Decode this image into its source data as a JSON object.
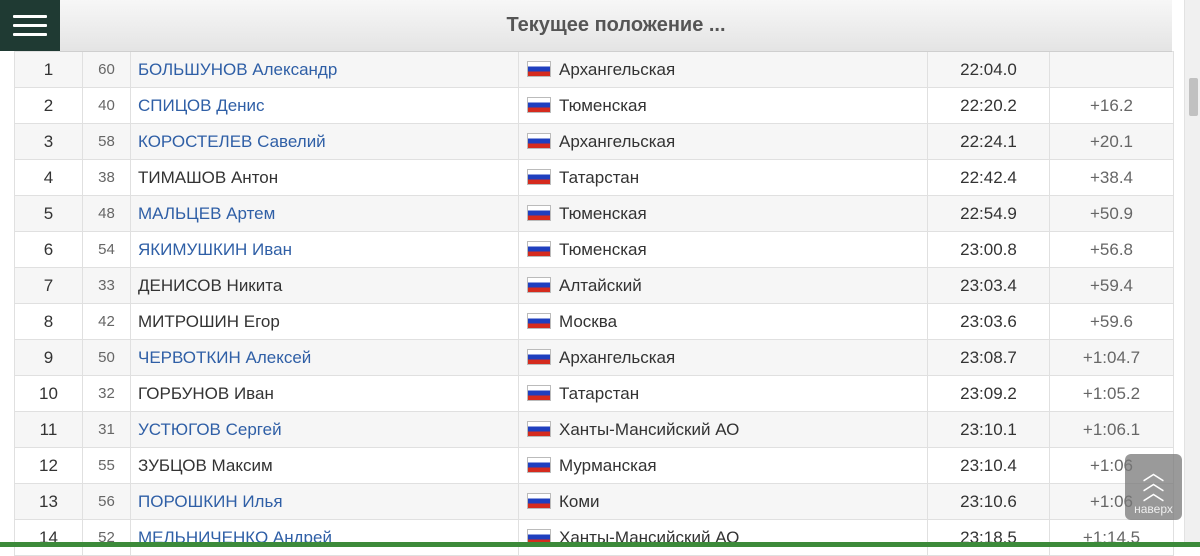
{
  "header": {
    "title": "Текущее положение ..."
  },
  "back_to_top": {
    "label": "наверх"
  },
  "results": [
    {
      "place": "1",
      "bib": "60",
      "name": "БОЛЬШУНОВ Александр",
      "link": true,
      "region": "Архангельская",
      "time": "22:04.0",
      "gap": ""
    },
    {
      "place": "2",
      "bib": "40",
      "name": "СПИЦОВ Денис",
      "link": true,
      "region": "Тюменская",
      "time": "22:20.2",
      "gap": "+16.2"
    },
    {
      "place": "3",
      "bib": "58",
      "name": "КОРОСТЕЛЕВ Савелий",
      "link": true,
      "region": "Архангельская",
      "time": "22:24.1",
      "gap": "+20.1"
    },
    {
      "place": "4",
      "bib": "38",
      "name": "ТИМАШОВ Антон",
      "link": false,
      "region": "Татарстан",
      "time": "22:42.4",
      "gap": "+38.4"
    },
    {
      "place": "5",
      "bib": "48",
      "name": "МАЛЬЦЕВ Артем",
      "link": true,
      "region": "Тюменская",
      "time": "22:54.9",
      "gap": "+50.9"
    },
    {
      "place": "6",
      "bib": "54",
      "name": "ЯКИМУШКИН Иван",
      "link": true,
      "region": "Тюменская",
      "time": "23:00.8",
      "gap": "+56.8"
    },
    {
      "place": "7",
      "bib": "33",
      "name": "ДЕНИСОВ Никита",
      "link": false,
      "region": "Алтайский",
      "time": "23:03.4",
      "gap": "+59.4"
    },
    {
      "place": "8",
      "bib": "42",
      "name": "МИТРОШИН Егор",
      "link": false,
      "region": "Москва",
      "time": "23:03.6",
      "gap": "+59.6"
    },
    {
      "place": "9",
      "bib": "50",
      "name": "ЧЕРВОТКИН Алексей",
      "link": true,
      "region": "Архангельская",
      "time": "23:08.7",
      "gap": "+1:04.7"
    },
    {
      "place": "10",
      "bib": "32",
      "name": "ГОРБУНОВ Иван",
      "link": false,
      "region": "Татарстан",
      "time": "23:09.2",
      "gap": "+1:05.2"
    },
    {
      "place": "11",
      "bib": "31",
      "name": "УСТЮГОВ Сергей",
      "link": true,
      "region": "Ханты-Мансийский АО",
      "time": "23:10.1",
      "gap": "+1:06.1"
    },
    {
      "place": "12",
      "bib": "55",
      "name": "ЗУБЦОВ Максим",
      "link": false,
      "region": "Мурманская",
      "time": "23:10.4",
      "gap": "+1:06"
    },
    {
      "place": "13",
      "bib": "56",
      "name": "ПОРОШКИН Илья",
      "link": true,
      "region": "Коми",
      "time": "23:10.6",
      "gap": "+1:06"
    },
    {
      "place": "14",
      "bib": "52",
      "name": "МЕЛЬНИЧЕНКО Андрей",
      "link": true,
      "region": "Ханты-Мансийский АО",
      "time": "23:18.5",
      "gap": "+1:14.5"
    }
  ]
}
